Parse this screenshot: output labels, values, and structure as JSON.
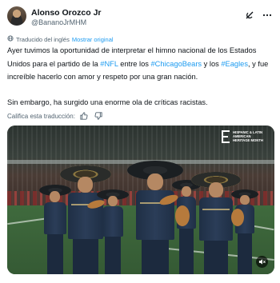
{
  "author": {
    "display_name": "Alonso Orozco Jr",
    "handle": "@BananoJrMHM"
  },
  "translation": {
    "label": "Traducido del inglés",
    "show_original": "Mostrar original"
  },
  "tweet": {
    "para1_part1": "Ayer tuvimos la oportunidad de interpretar el himno nacional de los Estados Unidos para el partido de la ",
    "hashtag_nfl": "#NFL",
    "para1_part2": " entre los ",
    "hashtag_bears": "#ChicagoBears",
    "para1_part3": " y los ",
    "hashtag_eagles": "#Eagles",
    "para1_part4": ", y fue increíble hacerlo con amor y respeto por una gran nación.",
    "para2": "Sin embargo, ha surgido una enorme ola de críticas racistas."
  },
  "rate_translation": {
    "label": "Califica esta traducción:"
  },
  "video": {
    "overlay_logo_text": "HISPANIC & LATIN AMERICAN HERITAGE MONTH"
  },
  "icons": {
    "grok": "grok-icon",
    "more": "more-icon",
    "translate": "globe-icon",
    "thumbs_up": "thumbs-up-icon",
    "thumbs_down": "thumbs-down-icon",
    "mute": "speaker-muted-icon"
  },
  "colors": {
    "link": "#1d9bf0",
    "text": "#0f1419",
    "secondary": "#536471"
  }
}
